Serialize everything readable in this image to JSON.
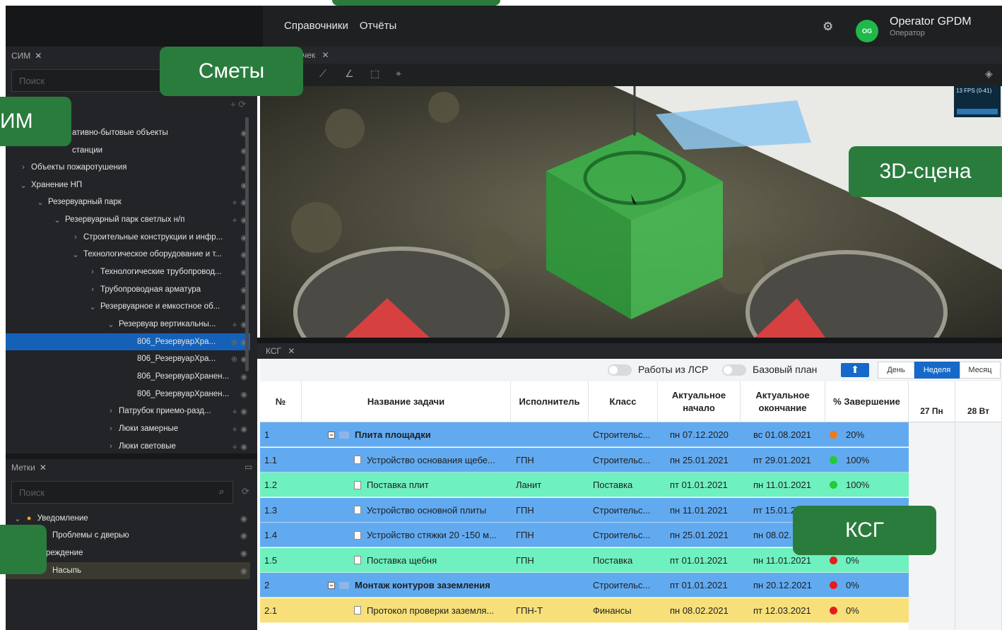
{
  "topbar": {
    "menu": [
      "Справочники",
      "Отчёты"
    ],
    "user_name": "Operator GPDM",
    "user_role": "Оператор",
    "avatar_initials": "OG",
    "icons": [
      "gear-icon"
    ]
  },
  "left_panel": {
    "tab_label": "СИМ",
    "search_placeholder": "Поиск",
    "tree": [
      {
        "label": "ативно-бытовые объекты"
      },
      {
        "label": "станции"
      },
      {
        "label": "Объекты пожаротушения"
      },
      {
        "label": "Хранение НП"
      },
      {
        "label": "Резервуарный парк"
      },
      {
        "label": "Резервуарный парк светлых н/п"
      },
      {
        "label": "Строительные конструкции и инфр..."
      },
      {
        "label": "Технологическое оборудование и т..."
      },
      {
        "label": "Технологические трубопровод..."
      },
      {
        "label": "Трубопроводная арматура"
      },
      {
        "label": "Резервуарное и емкостное об..."
      },
      {
        "label": "Резервуар вертикальны..."
      },
      {
        "label": "806_РезервуарХра..."
      },
      {
        "label": "806_РезервуарХра..."
      },
      {
        "label": "806_РезервуарХранен..."
      },
      {
        "label": "806_РезервуарХранен..."
      },
      {
        "label": "Патрубок приемо-разд..."
      },
      {
        "label": "Люки замерные"
      },
      {
        "label": "Люки световые"
      }
    ]
  },
  "marks_panel": {
    "tab_label": "Метки",
    "search_placeholder": "Поиск",
    "items": [
      {
        "label": "Уведомление"
      },
      {
        "label": "Проблемы с дверью"
      },
      {
        "label": "едупреждение"
      },
      {
        "label": "Насыпь"
      }
    ]
  },
  "scene": {
    "tab_label": "чек",
    "fps_text": "13 FPS (0-41)"
  },
  "ksg": {
    "tab_label": "КСГ",
    "toggle_works": "Работы из ЛСР",
    "toggle_base": "Базовый план",
    "view_day": "День",
    "view_week": "Неделя",
    "view_month": "Месяц",
    "headers": {
      "num": "№",
      "name": "Название задачи",
      "executor": "Исполнитель",
      "class": "Класс",
      "start": "Актуальное начало",
      "end": "Актуальное окончание",
      "percent": "% Завершение",
      "day1": "27 Пн",
      "day2": "28 Вт"
    },
    "rows": [
      {
        "num": "1",
        "name": "Плита площадки",
        "executor": "",
        "class": "Строительс...",
        "start": "пн 07.12.2020",
        "end": "вс 01.08.2021",
        "percent": "20%",
        "status_color": "#f07a1a",
        "row_color": "#62aaf0",
        "group": true
      },
      {
        "num": "1.1",
        "name": "Устройство основания щебе...",
        "executor": "ГПН",
        "class": "Строительс...",
        "start": "пн 25.01.2021",
        "end": "пт 29.01.2021",
        "percent": "100%",
        "status_color": "#22cc33",
        "row_color": "#62aaf0",
        "group": false
      },
      {
        "num": "1.2",
        "name": "Поставка плит",
        "executor": "Ланит",
        "class": "Поставка",
        "start": "пт 01.01.2021",
        "end": "пн 11.01.2021",
        "percent": "100%",
        "status_color": "#22cc33",
        "row_color": "#6ff0bf",
        "group": false
      },
      {
        "num": "1.3",
        "name": "Устройство основной плиты",
        "executor": "ГПН",
        "class": "Строительс...",
        "start": "пн 11.01.2021",
        "end": "пт 15.01.2",
        "percent": "",
        "status_color": "",
        "row_color": "#62aaf0",
        "group": false
      },
      {
        "num": "1.4",
        "name": "Устройство стяжки 20 -150 м...",
        "executor": "ГПН",
        "class": "Строительс...",
        "start": "пн 25.01.2021",
        "end": "пн 08.02.",
        "percent": "",
        "status_color": "",
        "row_color": "#62aaf0",
        "group": false
      },
      {
        "num": "1.5",
        "name": "Поставка щебня",
        "executor": "ГПН",
        "class": "Поставка",
        "start": "пт 01.01.2021",
        "end": "пн 11.01.2021",
        "percent": "0%",
        "status_color": "#e51c1c",
        "row_color": "#6ff0bf",
        "group": false
      },
      {
        "num": "2",
        "name": "Монтаж контуров заземления",
        "executor": "",
        "class": "Строительс...",
        "start": "пт 01.01.2021",
        "end": "пн 20.12.2021",
        "percent": "0%",
        "status_color": "#e51c1c",
        "row_color": "#62aaf0",
        "group": true
      },
      {
        "num": "2.1",
        "name": "Протокол проверки заземля...",
        "executor": "ГПН-Т",
        "class": "Финансы",
        "start": "пн 08.02.2021",
        "end": "пт 12.03.2021",
        "percent": "0%",
        "status_color": "#e51c1c",
        "row_color": "#f7e07a",
        "group": false
      }
    ]
  },
  "callouts": {
    "smety": "Сметы",
    "sim_partial": "ИМ",
    "scene3d": "3D-сцена",
    "ksg": "КСГ"
  }
}
